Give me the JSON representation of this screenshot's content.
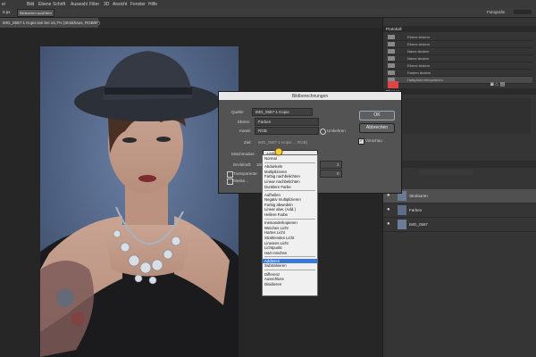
{
  "menubar": {
    "items": [
      "ei",
      "Bild",
      "Ebene",
      "Schrift",
      "Auswahl",
      "Filter",
      "3D",
      "Ansicht",
      "Fenster",
      "Hilfe"
    ]
  },
  "options_bar": {
    "value1": "0 px",
    "button": "Bildkanten ausfüllen",
    "right_label": "Fotografie"
  },
  "document": {
    "tab_title": "IMG_0587-1 Kopie.tan bei 16,7% (Strakhaus, RGB/8*)"
  },
  "history": {
    "header": "Protokoll",
    "items": [
      "Ebene ändern",
      "Ebene ändern",
      "Name ändern",
      "Name ändern",
      "Ebene ändern",
      "Farben ändern",
      "Halbplast interpolieren"
    ]
  },
  "layers": {
    "header": "Ebenen",
    "items": [
      {
        "name": "Strukturen"
      },
      {
        "name": "Farben"
      },
      {
        "name": "IMG_0587"
      }
    ]
  },
  "dialog": {
    "title": "Bildberechnungen",
    "quelle_label": "Quelle:",
    "quelle_value": "IMG_0587-1 Kopie",
    "ebene_label": "Ebene:",
    "ebene_value": "Farben",
    "kanal_label": "Kanal:",
    "kanal_value": "RGB",
    "umkehren_label": "Umkehren",
    "ziel_label": "Ziel:",
    "ziel_value": "IMG_0587-1 Kopie ... RGB)",
    "mischmodus_label": "Mischmodus:",
    "mischmodus_value": "Addieren",
    "deckkraft_label": "Deckkraft:",
    "deckkraft_value": "100",
    "skalierung_value": "2",
    "offset_value": "0",
    "transparenz_label": "Transparente",
    "maske_label": "Maske...",
    "ok_label": "OK",
    "cancel_label": "Abbrechen",
    "vorschau_label": "Vorschau",
    "vorschau_checked": true
  },
  "blend_menu": {
    "groups": [
      [
        "Normal"
      ],
      [
        "Abdunkeln",
        "Multiplizieren",
        "Farbig nachbelichten",
        "Linear nachbelichten",
        "Dunklere Farbe"
      ],
      [
        "Aufhellen",
        "Negativ multiplizieren",
        "Farbig abwedeln",
        "Linear abw. (Add.)",
        "Hellere Farbe"
      ],
      [
        "Ineinanderkopieren",
        "Weiches Licht",
        "Hartes Licht",
        "Strahlendes Licht",
        "Lineares Licht",
        "Lichtpunkt",
        "Hart mischen"
      ],
      [
        "Addieren",
        "Subtrahieren"
      ],
      [
        "Differenz",
        "Ausschluss",
        "Dividieren"
      ]
    ],
    "selected": "Addieren"
  },
  "colors": {
    "accent": "#3a78d6",
    "close": "#e04343"
  }
}
